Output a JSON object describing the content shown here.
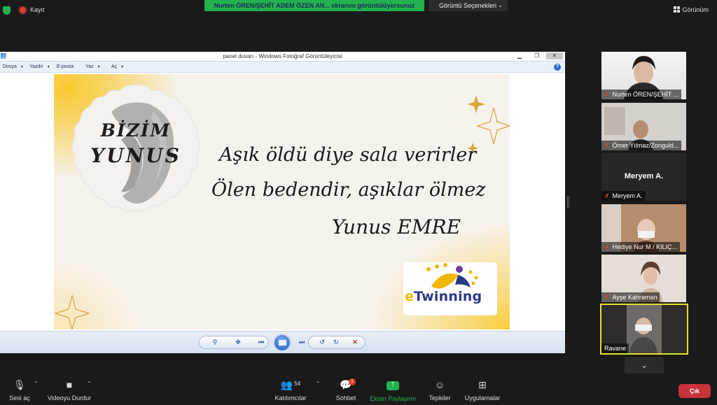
{
  "top_bar": {
    "record_label": "Kayıt",
    "share_banner": "Nurten ÖREN/ŞEHİT ADEM ÖZEN AN... ekranını görüntülüyorsunuz",
    "view_options": "Görüntü Seçenekleri",
    "view_label": "Görünüm"
  },
  "viewer": {
    "title": "panel duvarı - Windows Fotoğraf Görüntüleyicisi",
    "menu": [
      "Dosya",
      "Yazdır",
      "E-posta",
      "Yaz",
      "Aç"
    ],
    "slide": {
      "badge_line1": "BİZİM",
      "badge_line2": "YUNUS",
      "poem_line1": "Aşık öldü diye sala verirler",
      "poem_line2": "Ölen bedendir, aşıklar ölmez",
      "author": "Yunus EMRE",
      "logo_text": "Twinning",
      "logo_e": "e"
    }
  },
  "participants": [
    {
      "name": "Nurten ÖREN/ŞEHİT ...",
      "muted": true
    },
    {
      "name": "Ömer Yılmaz/Zonguld...",
      "muted": true
    },
    {
      "name": "Meryem A.",
      "display": "Meryem A.",
      "muted": true
    },
    {
      "name": "Hediye Nur M / KILIÇ...",
      "muted": true
    },
    {
      "name": "Ayşe Kahraman",
      "muted": true
    },
    {
      "name": "Ravane",
      "muted": false
    }
  ],
  "toolbar": {
    "mute_label": "Sesi aç",
    "video_label": "Videoyu Durdur",
    "participants_label": "Katılımcılar",
    "participants_count": "54",
    "chat_label": "Sohbet",
    "chat_badge": "1",
    "share_label": "Ekran Paylaşımı",
    "reactions_label": "Tepkiler",
    "apps_label": "Uygulamalar",
    "leave_label": "Çık"
  },
  "colors": {
    "share_green": "#23b14d",
    "leave_red": "#c8323a",
    "active_speaker": "#e6e02c",
    "mute_red": "#e0412f"
  }
}
